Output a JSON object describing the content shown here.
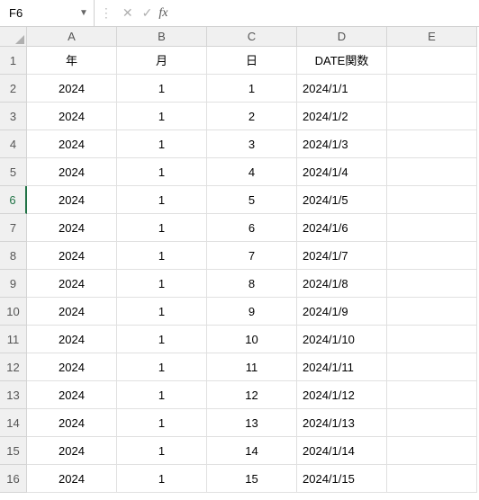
{
  "nameBox": "F6",
  "formula": "",
  "fxLabel": "fx",
  "columns": [
    "A",
    "B",
    "C",
    "D",
    "E"
  ],
  "rowNumbers": [
    1,
    2,
    3,
    4,
    5,
    6,
    7,
    8,
    9,
    10,
    11,
    12,
    13,
    14,
    15,
    16
  ],
  "activeRow": 6,
  "headerRow": {
    "A": "年",
    "B": "月",
    "C": "日",
    "D": "DATE関数",
    "E": ""
  },
  "dataRows": [
    {
      "A": "2024",
      "B": "1",
      "C": "1",
      "D": "2024/1/1",
      "E": ""
    },
    {
      "A": "2024",
      "B": "1",
      "C": "2",
      "D": "2024/1/2",
      "E": ""
    },
    {
      "A": "2024",
      "B": "1",
      "C": "3",
      "D": "2024/1/3",
      "E": ""
    },
    {
      "A": "2024",
      "B": "1",
      "C": "4",
      "D": "2024/1/4",
      "E": ""
    },
    {
      "A": "2024",
      "B": "1",
      "C": "5",
      "D": "2024/1/5",
      "E": ""
    },
    {
      "A": "2024",
      "B": "1",
      "C": "6",
      "D": "2024/1/6",
      "E": ""
    },
    {
      "A": "2024",
      "B": "1",
      "C": "7",
      "D": "2024/1/7",
      "E": ""
    },
    {
      "A": "2024",
      "B": "1",
      "C": "8",
      "D": "2024/1/8",
      "E": ""
    },
    {
      "A": "2024",
      "B": "1",
      "C": "9",
      "D": "2024/1/9",
      "E": ""
    },
    {
      "A": "2024",
      "B": "1",
      "C": "10",
      "D": "2024/1/10",
      "E": ""
    },
    {
      "A": "2024",
      "B": "1",
      "C": "11",
      "D": "2024/1/11",
      "E": ""
    },
    {
      "A": "2024",
      "B": "1",
      "C": "12",
      "D": "2024/1/12",
      "E": ""
    },
    {
      "A": "2024",
      "B": "1",
      "C": "13",
      "D": "2024/1/13",
      "E": ""
    },
    {
      "A": "2024",
      "B": "1",
      "C": "14",
      "D": "2024/1/14",
      "E": ""
    },
    {
      "A": "2024",
      "B": "1",
      "C": "15",
      "D": "2024/1/15",
      "E": ""
    }
  ]
}
